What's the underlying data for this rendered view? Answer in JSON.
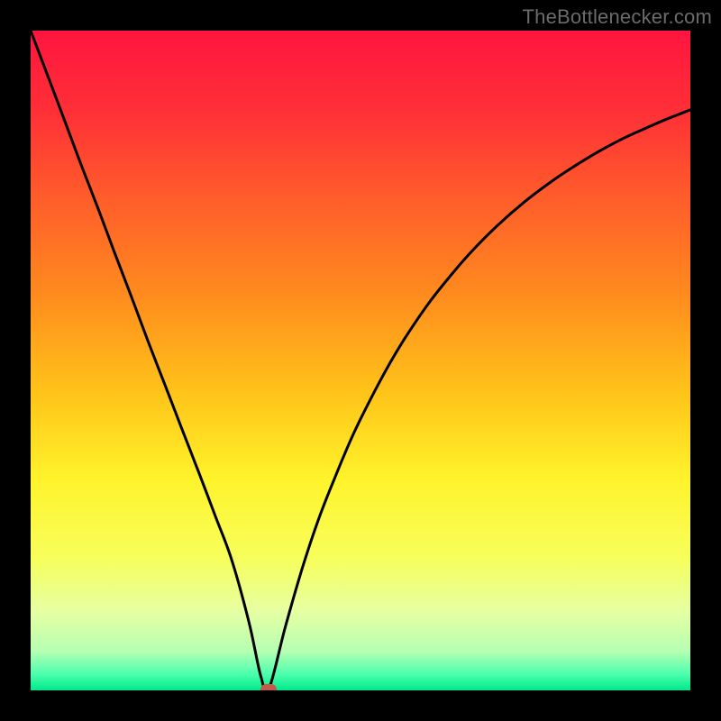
{
  "watermark": {
    "text": "TheBottlenecker.com"
  },
  "chart_data": {
    "type": "line",
    "title": "",
    "xlabel": "",
    "ylabel": "",
    "xlim": [
      0,
      100
    ],
    "ylim": [
      0,
      100
    ],
    "axes_visible": false,
    "grid": false,
    "background": "rainbow-vertical-gradient",
    "gradient_stops": [
      {
        "offset": 0.0,
        "color": "#ff153f"
      },
      {
        "offset": 0.12,
        "color": "#ff2f37"
      },
      {
        "offset": 0.25,
        "color": "#ff5b2b"
      },
      {
        "offset": 0.4,
        "color": "#ff8b1e"
      },
      {
        "offset": 0.55,
        "color": "#ffc419"
      },
      {
        "offset": 0.68,
        "color": "#fff32b"
      },
      {
        "offset": 0.8,
        "color": "#f7ff5c"
      },
      {
        "offset": 0.88,
        "color": "#e6ffa2"
      },
      {
        "offset": 0.94,
        "color": "#b7ffb3"
      },
      {
        "offset": 0.975,
        "color": "#4dffad"
      },
      {
        "offset": 1.0,
        "color": "#00e98a"
      }
    ],
    "series": [
      {
        "name": "bottleneck-curve",
        "stroke": "#000000",
        "stroke_width": 3,
        "x": [
          0.0,
          2.5,
          5.1,
          7.6,
          10.2,
          12.7,
          15.3,
          17.8,
          20.4,
          22.9,
          25.5,
          28.0,
          30.5,
          33.1,
          34.9,
          36.1,
          38.6,
          41.2,
          43.7,
          46.3,
          48.8,
          51.4,
          54.4,
          57.0,
          60.5,
          64.1,
          67.1,
          70.8,
          74.8,
          78.9,
          82.5,
          86.5,
          90.1,
          93.2,
          96.2,
          100.0
        ],
        "values": [
          100.0,
          93.4,
          86.5,
          79.8,
          73.1,
          66.4,
          59.6,
          52.9,
          46.2,
          39.7,
          33.0,
          26.4,
          19.7,
          10.3,
          2.1,
          0.2,
          9.6,
          18.6,
          26.1,
          32.7,
          38.6,
          43.9,
          49.5,
          53.8,
          58.9,
          63.4,
          66.8,
          70.5,
          74.0,
          77.1,
          79.5,
          81.9,
          83.8,
          85.2,
          86.5,
          88.0
        ]
      }
    ],
    "marker": {
      "x": 36.0,
      "y": 0.2,
      "color": "#c25b4a",
      "name": "optimal-point"
    }
  }
}
